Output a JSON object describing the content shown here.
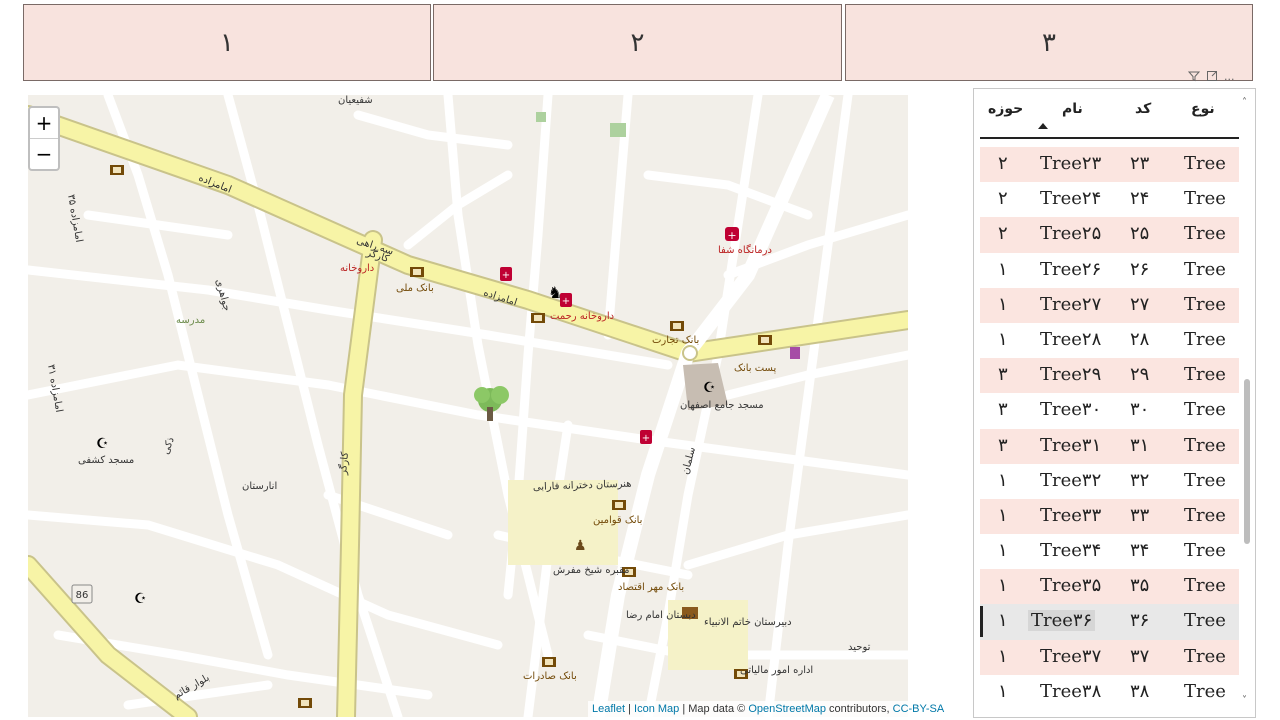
{
  "cards": [
    "۱",
    "۲",
    "۳"
  ],
  "visual_header": {
    "filter_icon": "filter-icon",
    "focus_icon": "focus-mode-icon",
    "more_icon": "more-options-icon",
    "more_label": "..."
  },
  "map": {
    "zoom_in": "+",
    "zoom_out": "−",
    "labels": {
      "imamzadeh1": "امامزاده",
      "imamzadeh2": "امامزاده",
      "seh_rahi": "سه راهی",
      "kargar": "کارگر",
      "darukhaneh": "داروخانه",
      "bank_melli": "بانک ملی",
      "darukhaneh_rahmat": "داروخانه رحمت",
      "bank_tejarat": "بانک تجارت",
      "darmangah": "درمانگاه شفا",
      "post_bank": "پست بانک",
      "masjed_jame": "مسجد جامع اصفهان",
      "madreseh": "مدرسه",
      "masjed_kashfi": "مسجد کشفی",
      "anarestan": "انارستان",
      "honarestan": "هنرستان دخترانه فارابی",
      "bank_ghavamin": "بانک قوامین",
      "maghbareh": "مقبره شیخ مفرش",
      "bank_mehr": "بانک مهر اقتصاد",
      "dabestan_reza": "دبستان امام رضا",
      "dabirestan": "دبیرستان خاتم الانبیاء",
      "edareh": "اداره امور مالیاتی",
      "bank_saderat": "بانک صادرات",
      "bolvar_ghaem": "بلوار قائم",
      "salman": "سلمان",
      "tohid": "توحید",
      "shafiyan": "شفیعیان",
      "road86": "86",
      "imamzadeh35": "امامزاده ۳۵",
      "imamzadeh31": "امامزاده ۳۱",
      "kargar_v": "کارگر",
      "javaheri": "جواهری",
      "zaki": "ذکی"
    },
    "attribution": {
      "leaflet": "Leaflet",
      "sep1": " | ",
      "iconmap": "Icon Map",
      "mid": " | Map data © ",
      "osm": "OpenStreetMap",
      "tail": " contributors, ",
      "license": "CC-BY-SA"
    }
  },
  "table": {
    "headers": {
      "type": "نوع",
      "code": "کد",
      "name": "نام",
      "zone": "حوزه"
    },
    "rows": [
      {
        "type": "Tree",
        "code": "۲۳",
        "name": "Tree۲۳",
        "zone": "۲"
      },
      {
        "type": "Tree",
        "code": "۲۴",
        "name": "Tree۲۴",
        "zone": "۲"
      },
      {
        "type": "Tree",
        "code": "۲۵",
        "name": "Tree۲۵",
        "zone": "۲"
      },
      {
        "type": "Tree",
        "code": "۲۶",
        "name": "Tree۲۶",
        "zone": "۱"
      },
      {
        "type": "Tree",
        "code": "۲۷",
        "name": "Tree۲۷",
        "zone": "۱"
      },
      {
        "type": "Tree",
        "code": "۲۸",
        "name": "Tree۲۸",
        "zone": "۱"
      },
      {
        "type": "Tree",
        "code": "۲۹",
        "name": "Tree۲۹",
        "zone": "۳"
      },
      {
        "type": "Tree",
        "code": "۳۰",
        "name": "Tree۳۰",
        "zone": "۳"
      },
      {
        "type": "Tree",
        "code": "۳۱",
        "name": "Tree۳۱",
        "zone": "۳"
      },
      {
        "type": "Tree",
        "code": "۳۲",
        "name": "Tree۳۲",
        "zone": "۱"
      },
      {
        "type": "Tree",
        "code": "۳۳",
        "name": "Tree۳۳",
        "zone": "۱"
      },
      {
        "type": "Tree",
        "code": "۳۴",
        "name": "Tree۳۴",
        "zone": "۱"
      },
      {
        "type": "Tree",
        "code": "۳۵",
        "name": "Tree۳۵",
        "zone": "۱"
      },
      {
        "type": "Tree",
        "code": "۳۶",
        "name": "Tree۳۶",
        "zone": "۱"
      },
      {
        "type": "Tree",
        "code": "۳۷",
        "name": "Tree۳۷",
        "zone": "۱"
      },
      {
        "type": "Tree",
        "code": "۳۸",
        "name": "Tree۳۸",
        "zone": "۱"
      }
    ],
    "selected_row": 13,
    "scroll_up": "˄",
    "scroll_down": "˅"
  }
}
